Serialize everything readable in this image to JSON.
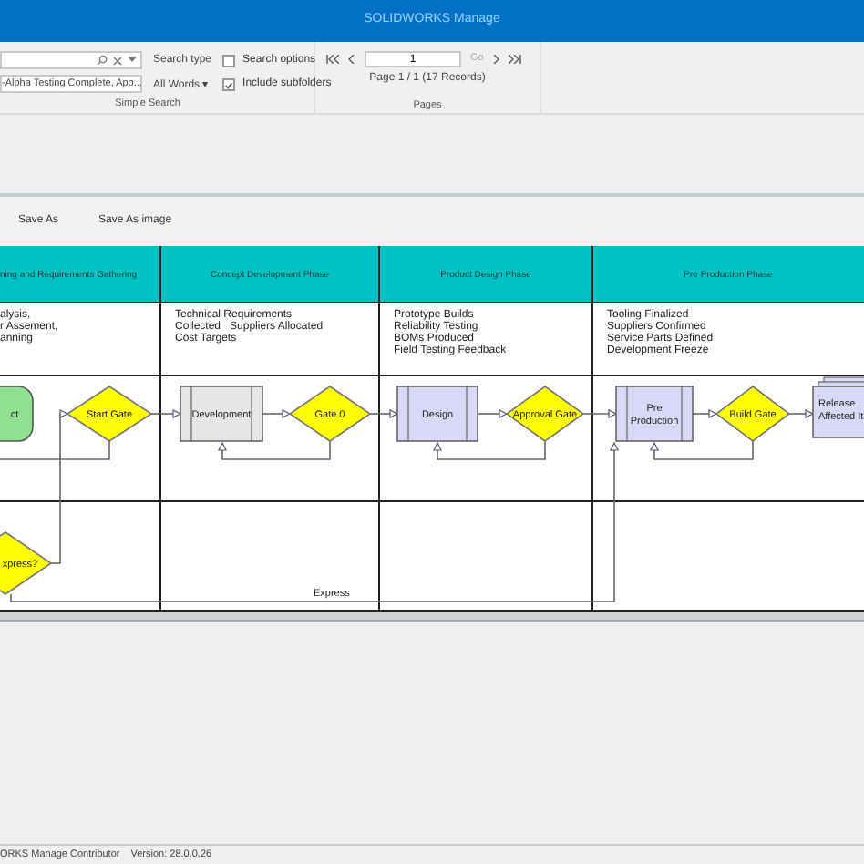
{
  "window": {
    "title": "SOLIDWORKS Manage"
  },
  "simple_search": {
    "filter_value": "-Alpha Testing Complete, App...",
    "search_type_label": "Search type",
    "search_type_value": "All Words ▾",
    "options": [
      {
        "label": "Search options",
        "checked": false
      },
      {
        "label": "Include subfolders",
        "checked": true
      }
    ],
    "group_label": "Simple Search"
  },
  "pages": {
    "page_value": "1",
    "go": "Go",
    "summary": "Page 1 / 1 (17 Records)",
    "group_label": "Pages"
  },
  "toolbar": [
    "Save As",
    "Save As image"
  ],
  "lanes": [
    {
      "header": "ning and Requirements Gathering",
      "notes": [
        "alysis,",
        "r Assement,",
        "anning"
      ]
    },
    {
      "header": "Concept Development Phase",
      "notes": [
        "Technical Requirements",
        "Collected   Suppliers Allocated",
        "Cost Targets"
      ]
    },
    {
      "header": "Product Design Phase",
      "notes": [
        "Prototype Builds",
        "Reliability Testing",
        "BOMs Produced",
        "Field Testing Feedback"
      ]
    },
    {
      "header": "Pre Production Phase",
      "notes": [
        "Tooling Finalized",
        "Suppliers Confirmed",
        "Service Parts Defined",
        "Development Freeze"
      ]
    }
  ],
  "nodes": [
    {
      "kind": "terminator",
      "lines": [
        "ct"
      ],
      "color": "#8fe08f"
    },
    {
      "kind": "gate",
      "lines": [
        "Start Gate"
      ],
      "color": "#ffff00"
    },
    {
      "kind": "process",
      "lines": [
        "Development"
      ],
      "color": "#e6e6e6"
    },
    {
      "kind": "gate",
      "lines": [
        "Gate 0"
      ],
      "color": "#ffff00"
    },
    {
      "kind": "process",
      "lines": [
        "Design"
      ],
      "color": "#d9d9f7"
    },
    {
      "kind": "gate",
      "lines": [
        "Approval Gate"
      ],
      "color": "#ffff00"
    },
    {
      "kind": "process",
      "lines": [
        "Pre",
        "Production"
      ],
      "color": "#d9d9f7"
    },
    {
      "kind": "gate",
      "lines": [
        "Build Gate"
      ],
      "color": "#ffff00"
    },
    {
      "kind": "document",
      "lines": [
        "Release",
        "Affected It"
      ],
      "color": "#d9d9f7"
    },
    {
      "kind": "gate",
      "lines": [
        "xpress?"
      ],
      "color": "#ffff00"
    }
  ],
  "connectors": [
    {
      "label": "Express"
    }
  ],
  "status_bar": [
    "ORKS Manage Contributor",
    "Version: 28.0.0.26"
  ]
}
